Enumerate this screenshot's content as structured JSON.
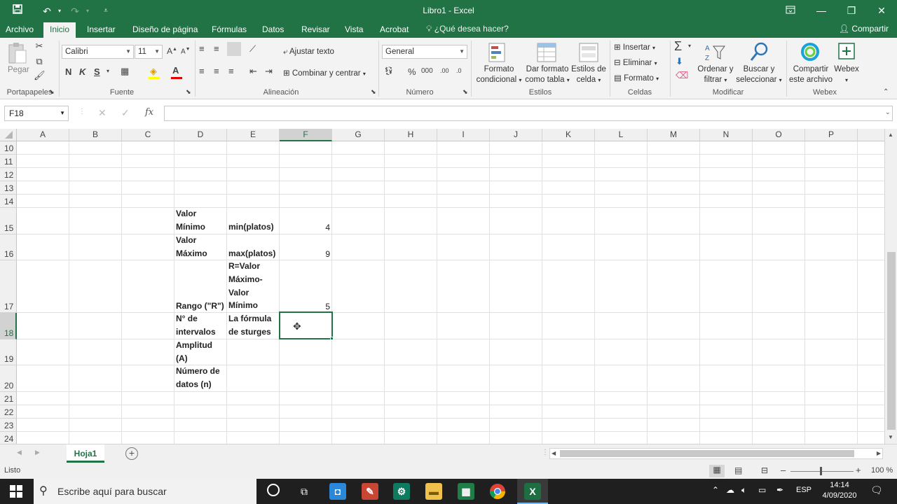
{
  "window": {
    "title": "Libro1  -  Excel"
  },
  "ribbon_tabs": [
    "Archivo",
    "Inicio",
    "Insertar",
    "Diseño de página",
    "Fórmulas",
    "Datos",
    "Revisar",
    "Vista",
    "Acrobat"
  ],
  "tell_me": "¿Qué desea hacer?",
  "share": "Compartir",
  "ribbon": {
    "paste": "Pegar",
    "font_name": "Calibri",
    "font_size": "11",
    "bold": "N",
    "italic": "K",
    "underline": "S",
    "wrap_text": "Ajustar texto",
    "merge_center": "Combinar y centrar",
    "number_format": "General",
    "conditional_format": [
      "Formato",
      "condicional"
    ],
    "format_as_table": [
      "Dar formato",
      "como tabla"
    ],
    "cell_styles": [
      "Estilos de",
      "celda"
    ],
    "insert": "Insertar",
    "delete": "Eliminar",
    "format": "Formato",
    "sort_filter": [
      "Ordenar y",
      "filtrar"
    ],
    "find_select": [
      "Buscar y",
      "seleccionar"
    ],
    "share_file": [
      "Compartir",
      "este archivo"
    ],
    "webex": "Webex",
    "groups": {
      "clipboard": "Portapapeles",
      "font": "Fuente",
      "alignment": "Alineación",
      "number": "Número",
      "styles": "Estilos",
      "cells": "Celdas",
      "editing": "Modificar",
      "webex": "Webex"
    }
  },
  "name_box": "F18",
  "formula": "",
  "columns": [
    "A",
    "B",
    "C",
    "D",
    "E",
    "F",
    "G",
    "H",
    "I",
    "J",
    "K",
    "L",
    "M",
    "N",
    "O",
    "P"
  ],
  "rows": [
    "10",
    "11",
    "12",
    "13",
    "14",
    "15",
    "16",
    "17",
    "18",
    "19",
    "20",
    "21",
    "22",
    "23",
    "24"
  ],
  "cells": {
    "D15": [
      "Valor",
      "Mínimo"
    ],
    "E15": "min(platos)",
    "F15": "4",
    "D16": [
      "Valor",
      "Máximo"
    ],
    "E16": "max(platos)",
    "F16": "9",
    "D17": "Rango (\"R\")",
    "E17": [
      "R=Valor",
      "Máximo-",
      "Valor",
      "Mínimo"
    ],
    "F17": "5",
    "D18": [
      "N° de",
      "intervalos"
    ],
    "E18": [
      "La fórmula",
      "de sturges"
    ],
    "D19": [
      "Amplitud",
      "(A)"
    ],
    "D20": [
      "Número de",
      "datos (n)"
    ]
  },
  "sheet_tab": "Hoja1",
  "status": {
    "ready": "Listo",
    "zoom": "100 %"
  },
  "taskbar": {
    "search_placeholder": "Escribe aquí para buscar",
    "lang": "ESP",
    "time": "14:14",
    "date": "4/09/2020"
  },
  "colors": {
    "excel_green": "#217346"
  }
}
